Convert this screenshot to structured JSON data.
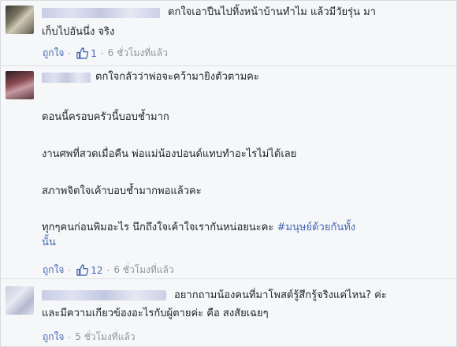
{
  "comments": [
    {
      "text_lines": [
        "ตกใจเอาปืนไปทิ้งหน้าบ้านทำไม แล้วมีวัยรุ่น มา",
        "เก็บไปอันนึ่ง จริง"
      ],
      "like_label": "ถูกใจ",
      "like_count": "1",
      "time": "6 ชั่วโมงที่แล้ว"
    },
    {
      "text_lines": [
        "ตกใจกลัวว่าพ่อจะคว้ามายิงตัวตามคะ",
        "ตอนนี้ครอบครัวนี้บอบช้ำมาก",
        "งานศพที่สวดเมื่อคืน พ่อแม่น้องปอนด์แทบทำอะไรไม่ได้เลย",
        "สภาพจิตใจเค้าบอบช้ำมากพอแล้วคะ",
        "ทุกๆคนก่อนพิมอะไร นึกถึงใจเค้าใจเรากันหน่อยนะคะ",
        "นั้น"
      ],
      "hashtag": "#มนุษย์ด้วยกันทั้ง",
      "like_label": "ถูกใจ",
      "like_count": "12",
      "time": "6 ชั่วโมงที่แล้ว"
    },
    {
      "text_lines": [
        "อยากถามน้องคนที่มาโพสต์รู้สึกรู้จริงแค่ไหน? ค่ะ",
        "และมีความเกียวข้องอะไรกับผู้ตายค่ะ คือ สงสัยเฉยๆ"
      ],
      "like_label": "ถูกใจ",
      "time": "5 ชั่วโมงที่แล้ว"
    }
  ],
  "separator_dot": "·",
  "colors": {
    "link": "#4267b2",
    "meta": "#90949c",
    "text": "#1d2129",
    "background": "#f6f7f9"
  },
  "icons": {
    "like": "thumbs-up-icon"
  }
}
